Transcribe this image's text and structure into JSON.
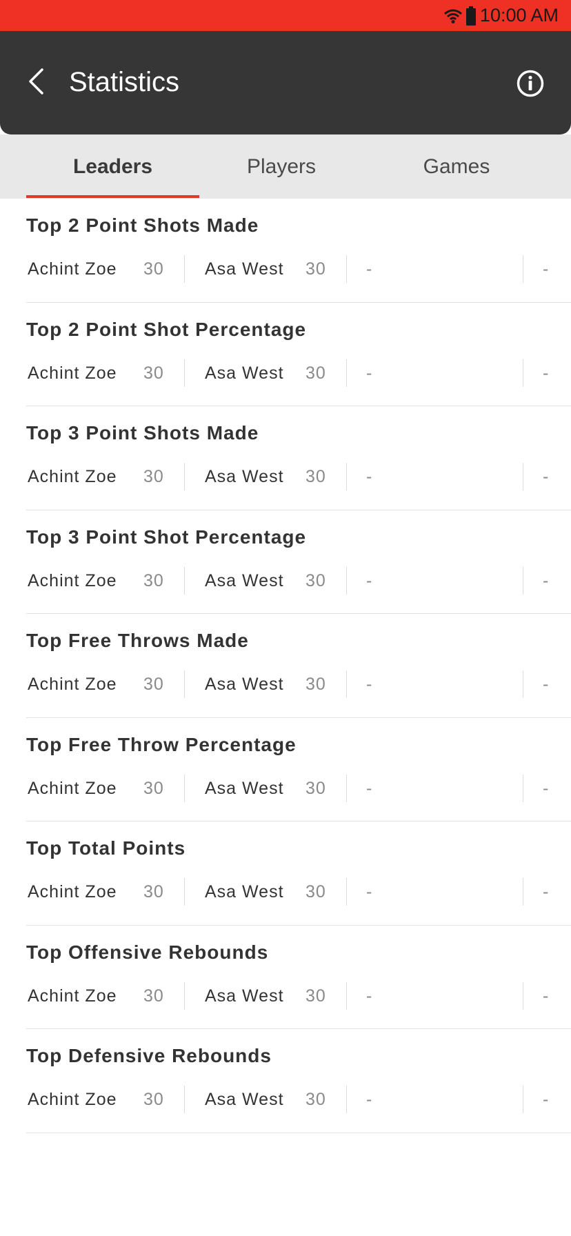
{
  "status_bar": {
    "time": "10:00 AM",
    "icons": [
      "wifi-icon",
      "battery-icon"
    ]
  },
  "header": {
    "title": "Statistics",
    "back_icon": "chevron-left-icon",
    "info_icon": "info-icon"
  },
  "tabs": [
    {
      "label": "Leaders",
      "active": true
    },
    {
      "label": "Players",
      "active": false
    },
    {
      "label": "Games",
      "active": false
    }
  ],
  "colors": {
    "accent": "#ee3124",
    "header_bg": "#363636",
    "tab_bg": "#e8e8e8"
  },
  "sections": [
    {
      "title": "Top 2 Point Shots Made",
      "p1_name": "Achint Zoe",
      "p1_value": "30",
      "p2_name": "Asa West",
      "p2_value": "30",
      "p3": "-",
      "p4": "-"
    },
    {
      "title": "Top 2 Point Shot Percentage",
      "p1_name": "Achint Zoe",
      "p1_value": "30",
      "p2_name": "Asa West",
      "p2_value": "30",
      "p3": "-",
      "p4": "-"
    },
    {
      "title": "Top 3 Point Shots Made",
      "p1_name": "Achint Zoe",
      "p1_value": "30",
      "p2_name": "Asa West",
      "p2_value": "30",
      "p3": "-",
      "p4": "-"
    },
    {
      "title": "Top 3 Point Shot Percentage",
      "p1_name": "Achint Zoe",
      "p1_value": "30",
      "p2_name": "Asa West",
      "p2_value": "30",
      "p3": "-",
      "p4": "-"
    },
    {
      "title": "Top Free Throws Made",
      "p1_name": "Achint Zoe",
      "p1_value": "30",
      "p2_name": "Asa West",
      "p2_value": "30",
      "p3": "-",
      "p4": "-"
    },
    {
      "title": "Top Free Throw Percentage",
      "p1_name": "Achint Zoe",
      "p1_value": "30",
      "p2_name": "Asa West",
      "p2_value": "30",
      "p3": "-",
      "p4": "-"
    },
    {
      "title": "Top Total Points",
      "p1_name": "Achint Zoe",
      "p1_value": "30",
      "p2_name": "Asa West",
      "p2_value": "30",
      "p3": "-",
      "p4": "-"
    },
    {
      "title": "Top Offensive Rebounds",
      "p1_name": "Achint Zoe",
      "p1_value": "30",
      "p2_name": "Asa West",
      "p2_value": "30",
      "p3": "-",
      "p4": "-"
    },
    {
      "title": "Top Defensive Rebounds",
      "p1_name": "Achint Zoe",
      "p1_value": "30",
      "p2_name": "Asa West",
      "p2_value": "30",
      "p3": "-",
      "p4": "-"
    }
  ]
}
